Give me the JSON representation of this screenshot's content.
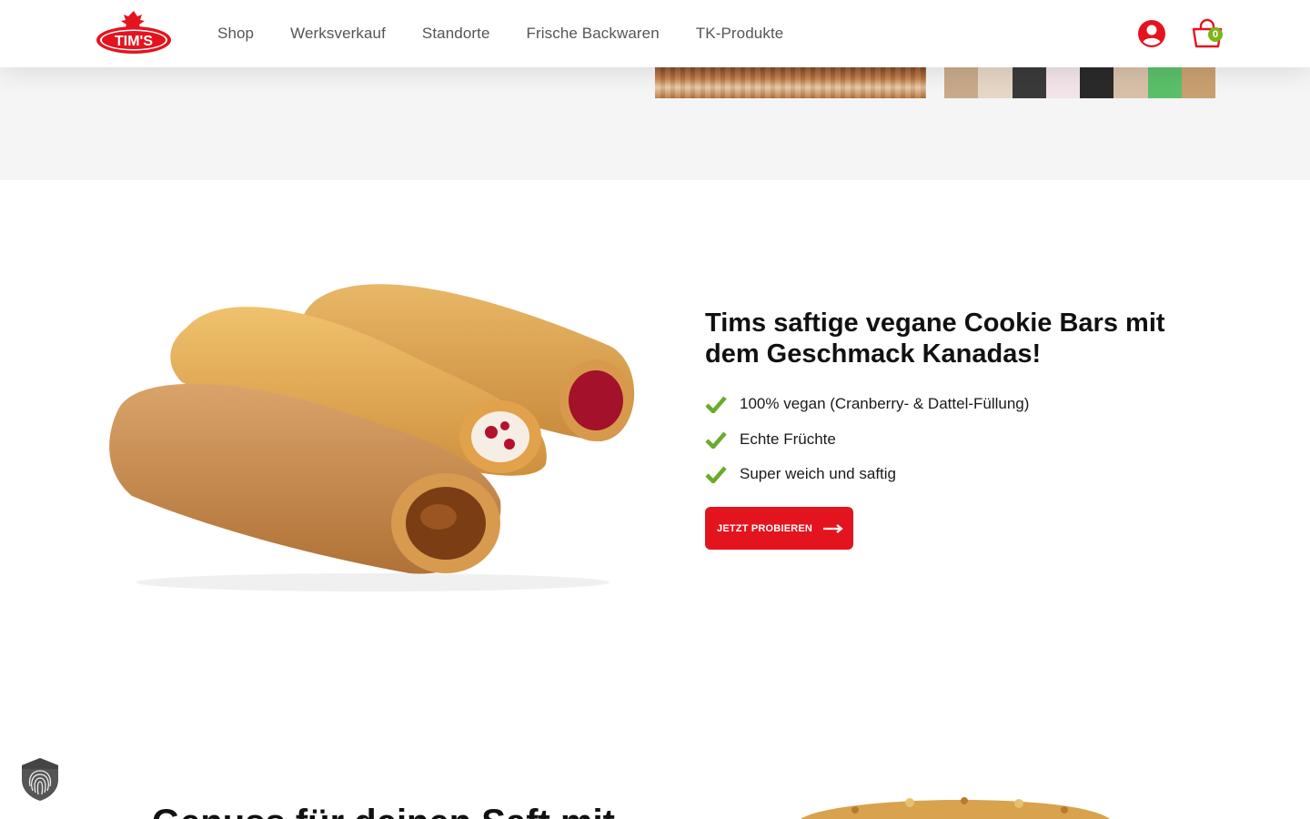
{
  "brand": {
    "logo_text": "TIM'S",
    "accent": "#e3141e",
    "cart_badge_color": "#7cb518"
  },
  "nav": {
    "items": [
      {
        "label": "Shop"
      },
      {
        "label": "Werksverkauf"
      },
      {
        "label": "Standorte"
      },
      {
        "label": "Frische Backwaren"
      },
      {
        "label": "TK-Produkte"
      }
    ]
  },
  "header_icons": {
    "account": "user-circle-icon",
    "cart": "shopping-bag-icon",
    "cart_count": "0"
  },
  "hero": {
    "title": "Tims saftige vegane Cookie Bars mit dem Geschmack Kanadas!",
    "features": [
      {
        "label": "100% vegan (Cranberry- & Dattel-Füllung)"
      },
      {
        "label": "Echte Früchte"
      },
      {
        "label": "Super weich und saftig"
      }
    ],
    "cta_label": "JETZT PROBIEREN",
    "image": "cookie-bars-photo"
  },
  "next_section": {
    "heading_partial": "Genuss für deinen Saft mit"
  },
  "privacy_widget": {
    "icon": "fingerprint-icon"
  }
}
